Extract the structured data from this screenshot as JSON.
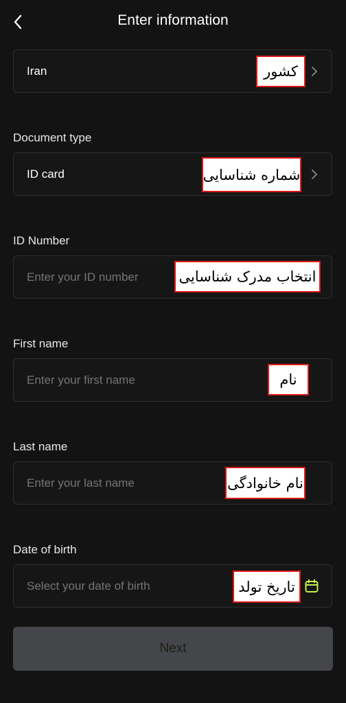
{
  "header": {
    "title": "Enter information"
  },
  "country": {
    "value": "Iran",
    "annotation": "کشور"
  },
  "document_type": {
    "label": "Document type",
    "value": "ID card",
    "annotation": "شماره شناسایی"
  },
  "id_number": {
    "label": "ID Number",
    "placeholder": "Enter your ID number",
    "annotation": "انتخاب مدرک شناسایی"
  },
  "first_name": {
    "label": "First name",
    "placeholder": "Enter your first name",
    "annotation": "نام"
  },
  "last_name": {
    "label": "Last name",
    "placeholder": "Enter your last name",
    "annotation": "نام خانوادگی"
  },
  "date_of_birth": {
    "label": "Date of birth",
    "placeholder": "Select your date of birth",
    "annotation": "تاریخ تولد",
    "icon": "calendar-icon"
  },
  "next_button": {
    "label": "Next"
  },
  "colors": {
    "background": "#131313",
    "card_border": "#2e2e2e",
    "button_bg": "#45464a",
    "accent_icon": "#c6f24a",
    "annotation_border": "#e01818"
  }
}
